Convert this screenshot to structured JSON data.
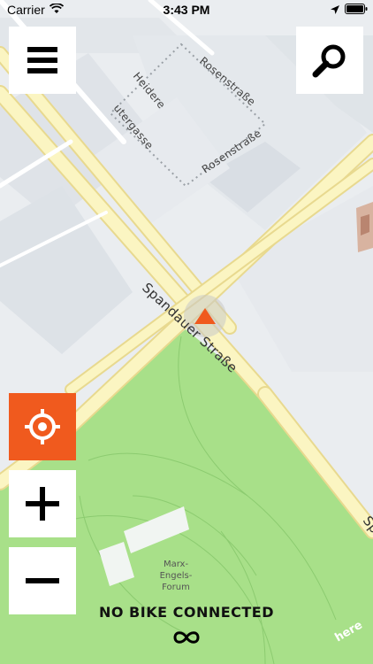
{
  "status_bar": {
    "carrier": "Carrier",
    "time": "3:43 PM"
  },
  "map": {
    "streets": {
      "rosenstrasse_top": "Rosenstraße",
      "rosenstrasse_bottom": "Rosenstraße",
      "heidereutergasse_1": "Heidere",
      "heidereutergasse_2": "utergasse",
      "spandauer": "Spandauer Straße",
      "spandauer_edge": "Sp"
    },
    "poi": {
      "line1": "Marx-",
      "line2": "Engels-",
      "line3": "Forum"
    },
    "colors": {
      "park": "#a8e089",
      "road": "#fbf5c2",
      "road_edge": "#e8d98f",
      "building": "#dde2e7",
      "ground": "#eaedf0",
      "accent": "#f05a1e"
    }
  },
  "controls": {
    "menu_icon": "hamburger-icon",
    "search_icon": "search-icon",
    "locate_icon": "crosshair-icon",
    "zoom_in_icon": "plus-icon",
    "zoom_out_icon": "minus-icon"
  },
  "bike": {
    "status": "NO BIKE CONNECTED",
    "icon": "infinity-icon"
  },
  "attribution": "here"
}
